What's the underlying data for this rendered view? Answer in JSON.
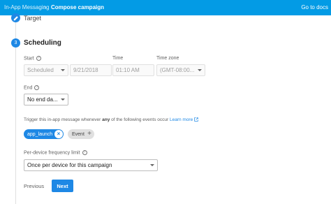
{
  "breadcrumb": {
    "parent": "In-App Messaging",
    "current": "Compose campaign",
    "docs_link": "Go to docs"
  },
  "steps": {
    "target_label": "Target",
    "scheduling_number": "3",
    "scheduling_title": "Scheduling"
  },
  "start": {
    "label": "Start",
    "type_value": "Scheduled",
    "time_label": "Time",
    "timezone_label": "Time zone",
    "date_value": "9/21/2018",
    "time_value": "01:10 AM",
    "timezone_value": "(GMT-08:00..."
  },
  "end": {
    "label": "End",
    "value": "No end da..."
  },
  "trigger": {
    "prefix": "Trigger this in-app message whenever ",
    "emphasis": "any",
    "suffix": " of the following events occur ",
    "learn_more": "Learn more"
  },
  "events": {
    "selected_chip": "app_launch",
    "add_chip": "Event"
  },
  "frequency": {
    "label": "Per-device frequency limit",
    "value": "Once per device for this campaign"
  },
  "actions": {
    "previous": "Previous",
    "next": "Next"
  },
  "colors": {
    "top_bar": "#039be5",
    "accent": "#1e88e5"
  }
}
